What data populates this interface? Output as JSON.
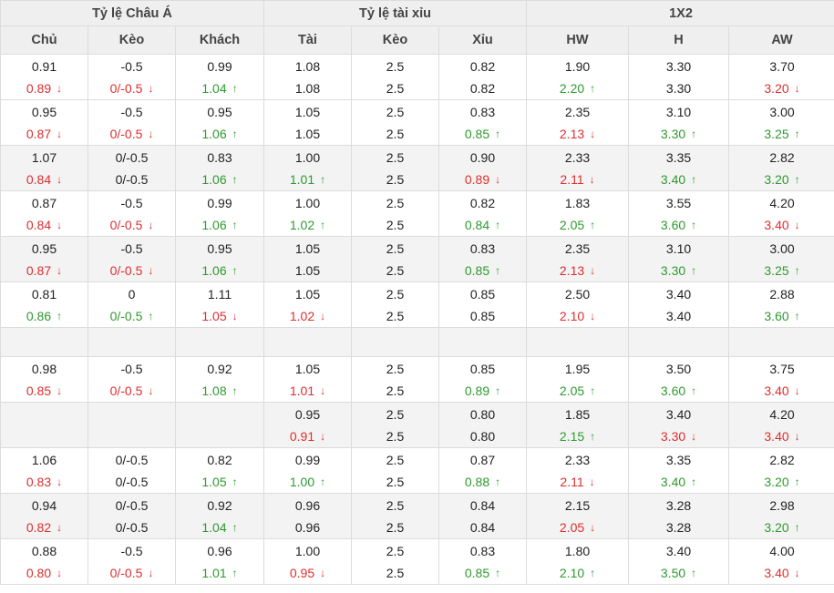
{
  "header": {
    "groups": [
      {
        "label": "Tỷ lệ Châu Á",
        "span": 3
      },
      {
        "label": "Tỷ lệ tài xỉu",
        "span": 3
      },
      {
        "label": "1X2",
        "span": 3
      }
    ],
    "columns": [
      "Chủ",
      "Kèo",
      "Khách",
      "Tài",
      "Kèo",
      "Xỉu",
      "HW",
      "H",
      "AW"
    ]
  },
  "arrows": {
    "up": "↑",
    "down": "↓"
  },
  "colors": {
    "up": "#2e9a2e",
    "down": "#e02d2d",
    "header_bg": "#efefef",
    "alt_row_bg": "#f3f3f3"
  },
  "rows": [
    {
      "type": "pair",
      "alt": false,
      "cells": [
        [
          "0.91",
          "0.89",
          "down"
        ],
        [
          "-0.5",
          "0/-0.5",
          "down"
        ],
        [
          "0.99",
          "1.04",
          "up"
        ],
        [
          "1.08",
          "1.08",
          ""
        ],
        [
          "2.5",
          "2.5",
          ""
        ],
        [
          "0.82",
          "0.82",
          ""
        ],
        [
          "1.90",
          "2.20",
          "up"
        ],
        [
          "3.30",
          "3.30",
          ""
        ],
        [
          "3.70",
          "3.20",
          "down"
        ]
      ]
    },
    {
      "type": "pair",
      "alt": false,
      "cells": [
        [
          "0.95",
          "0.87",
          "down"
        ],
        [
          "-0.5",
          "0/-0.5",
          "down"
        ],
        [
          "0.95",
          "1.06",
          "up"
        ],
        [
          "1.05",
          "1.05",
          ""
        ],
        [
          "2.5",
          "2.5",
          ""
        ],
        [
          "0.83",
          "0.85",
          "up"
        ],
        [
          "2.35",
          "2.13",
          "down"
        ],
        [
          "3.10",
          "3.30",
          "up"
        ],
        [
          "3.00",
          "3.25",
          "up"
        ]
      ]
    },
    {
      "type": "pair",
      "alt": true,
      "cells": [
        [
          "1.07",
          "0.84",
          "down"
        ],
        [
          "0/-0.5",
          "0/-0.5",
          ""
        ],
        [
          "0.83",
          "1.06",
          "up"
        ],
        [
          "1.00",
          "1.01",
          "up"
        ],
        [
          "2.5",
          "2.5",
          ""
        ],
        [
          "0.90",
          "0.89",
          "down"
        ],
        [
          "2.33",
          "2.11",
          "down"
        ],
        [
          "3.35",
          "3.40",
          "up"
        ],
        [
          "2.82",
          "3.20",
          "up"
        ]
      ]
    },
    {
      "type": "pair",
      "alt": false,
      "cells": [
        [
          "0.87",
          "0.84",
          "down"
        ],
        [
          "-0.5",
          "0/-0.5",
          "down"
        ],
        [
          "0.99",
          "1.06",
          "up"
        ],
        [
          "1.00",
          "1.02",
          "up"
        ],
        [
          "2.5",
          "2.5",
          ""
        ],
        [
          "0.82",
          "0.84",
          "up"
        ],
        [
          "1.83",
          "2.05",
          "up"
        ],
        [
          "3.55",
          "3.60",
          "up"
        ],
        [
          "4.20",
          "3.40",
          "down"
        ]
      ]
    },
    {
      "type": "pair",
      "alt": true,
      "cells": [
        [
          "0.95",
          "0.87",
          "down"
        ],
        [
          "-0.5",
          "0/-0.5",
          "down"
        ],
        [
          "0.95",
          "1.06",
          "up"
        ],
        [
          "1.05",
          "1.05",
          ""
        ],
        [
          "2.5",
          "2.5",
          ""
        ],
        [
          "0.83",
          "0.85",
          "up"
        ],
        [
          "2.35",
          "2.13",
          "down"
        ],
        [
          "3.10",
          "3.30",
          "up"
        ],
        [
          "3.00",
          "3.25",
          "up"
        ]
      ]
    },
    {
      "type": "pair",
      "alt": false,
      "cells": [
        [
          "0.81",
          "0.86",
          "up"
        ],
        [
          "0",
          "0/-0.5",
          "up"
        ],
        [
          "1.11",
          "1.05",
          "down"
        ],
        [
          "1.05",
          "1.02",
          "down"
        ],
        [
          "2.5",
          "2.5",
          ""
        ],
        [
          "0.85",
          "0.85",
          ""
        ],
        [
          "2.50",
          "2.10",
          "down"
        ],
        [
          "3.40",
          "3.40",
          ""
        ],
        [
          "2.88",
          "3.60",
          "up"
        ]
      ]
    },
    {
      "type": "spacer",
      "alt": true
    },
    {
      "type": "pair",
      "alt": false,
      "cells": [
        [
          "0.98",
          "0.85",
          "down"
        ],
        [
          "-0.5",
          "0/-0.5",
          "down"
        ],
        [
          "0.92",
          "1.08",
          "up"
        ],
        [
          "1.05",
          "1.01",
          "down"
        ],
        [
          "2.5",
          "2.5",
          ""
        ],
        [
          "0.85",
          "0.89",
          "up"
        ],
        [
          "1.95",
          "2.05",
          "up"
        ],
        [
          "3.50",
          "3.60",
          "up"
        ],
        [
          "3.75",
          "3.40",
          "down"
        ]
      ]
    },
    {
      "type": "pair",
      "alt": true,
      "cells": [
        [
          "",
          "",
          ""
        ],
        [
          "",
          "",
          ""
        ],
        [
          "",
          "",
          ""
        ],
        [
          "0.95",
          "0.91",
          "down"
        ],
        [
          "2.5",
          "2.5",
          ""
        ],
        [
          "0.80",
          "0.80",
          ""
        ],
        [
          "1.85",
          "2.15",
          "up"
        ],
        [
          "3.40",
          "3.30",
          "down"
        ],
        [
          "4.20",
          "3.40",
          "down"
        ]
      ]
    },
    {
      "type": "pair",
      "alt": false,
      "cells": [
        [
          "1.06",
          "0.83",
          "down"
        ],
        [
          "0/-0.5",
          "0/-0.5",
          ""
        ],
        [
          "0.82",
          "1.05",
          "up"
        ],
        [
          "0.99",
          "1.00",
          "up"
        ],
        [
          "2.5",
          "2.5",
          ""
        ],
        [
          "0.87",
          "0.88",
          "up"
        ],
        [
          "2.33",
          "2.11",
          "down"
        ],
        [
          "3.35",
          "3.40",
          "up"
        ],
        [
          "2.82",
          "3.20",
          "up"
        ]
      ]
    },
    {
      "type": "pair",
      "alt": true,
      "cells": [
        [
          "0.94",
          "0.82",
          "down"
        ],
        [
          "0/-0.5",
          "0/-0.5",
          ""
        ],
        [
          "0.92",
          "1.04",
          "up"
        ],
        [
          "0.96",
          "0.96",
          ""
        ],
        [
          "2.5",
          "2.5",
          ""
        ],
        [
          "0.84",
          "0.84",
          ""
        ],
        [
          "2.15",
          "2.05",
          "down"
        ],
        [
          "3.28",
          "3.28",
          ""
        ],
        [
          "2.98",
          "3.20",
          "up"
        ]
      ]
    },
    {
      "type": "pair",
      "alt": false,
      "cells": [
        [
          "0.88",
          "0.80",
          "down"
        ],
        [
          "-0.5",
          "0/-0.5",
          "down"
        ],
        [
          "0.96",
          "1.01",
          "up"
        ],
        [
          "1.00",
          "0.95",
          "down"
        ],
        [
          "2.5",
          "2.5",
          ""
        ],
        [
          "0.83",
          "0.85",
          "up"
        ],
        [
          "1.80",
          "2.10",
          "up"
        ],
        [
          "3.40",
          "3.50",
          "up"
        ],
        [
          "4.00",
          "3.40",
          "down"
        ]
      ]
    }
  ]
}
